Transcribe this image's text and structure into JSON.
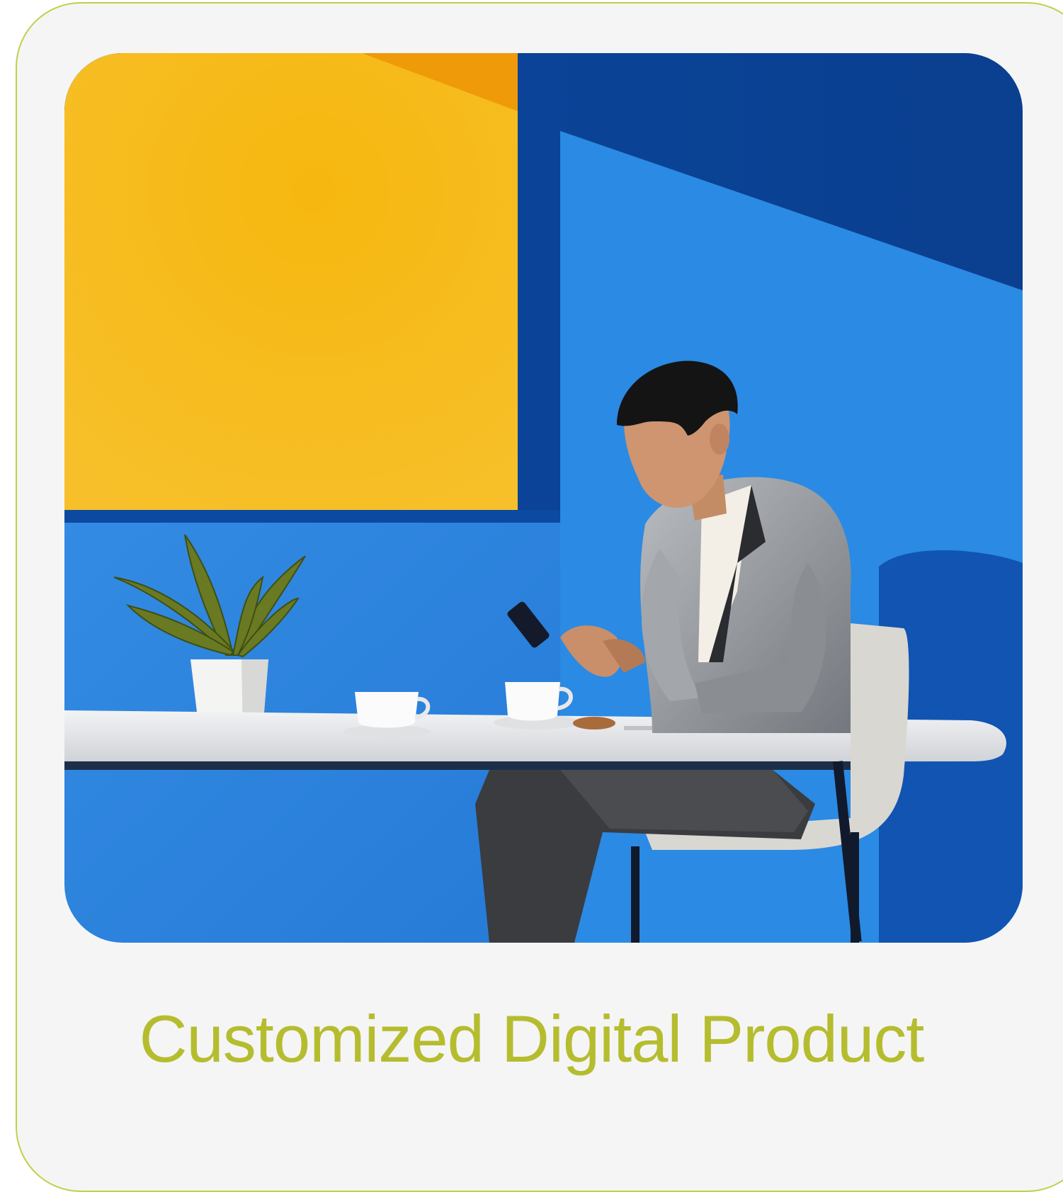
{
  "card": {
    "title": "Customized Digital Product",
    "title_color": "#b5bd2f",
    "border_color": "#c3cf4a",
    "background": "#f5f5f5"
  },
  "illustration": {
    "subject": "man in grey suit looking at phone at white table",
    "colors": {
      "wall_blue": "#2a86e0",
      "wall_dark": "#0a4ea8",
      "panel_yellow": "#f5b81e"
    }
  }
}
